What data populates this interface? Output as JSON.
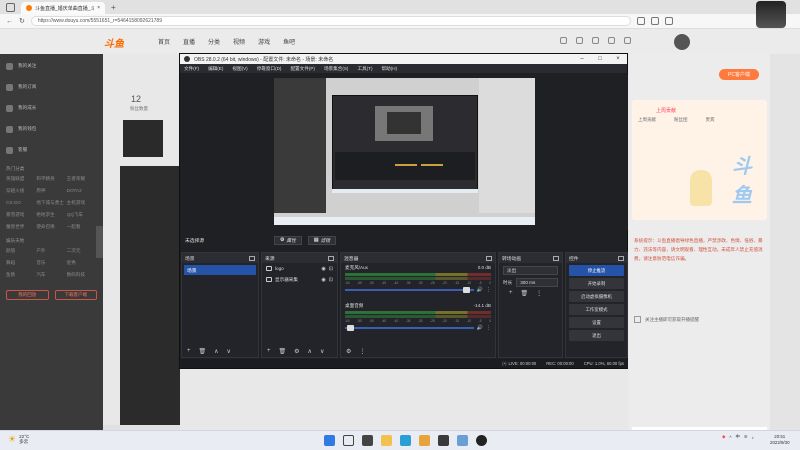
{
  "browser": {
    "tab_title": "斗鱼直播_婚庆单曲直播_斗...",
    "url": "https://www.douyu.com/5551651_r=5464158092621789"
  },
  "site": {
    "logo": "斗鱼",
    "nav": [
      "首页",
      "直播",
      "分类",
      "视频",
      "游戏",
      "鱼吧"
    ],
    "left_menu": [
      "我的关注",
      "我的订阅",
      "我的成长",
      "我的钱包",
      "客服"
    ],
    "sections": [
      {
        "title": "热门分类",
        "items": [
          "英雄联盟",
          "和平精英",
          "王者荣耀",
          "穿越火线",
          "原神",
          "DOTA2",
          "CS:GO",
          "地下城与勇士",
          "主机游戏",
          "暴雪游戏",
          "绝地求生",
          "QQ飞车",
          "魔兽世界",
          "使命召唤",
          "一起看"
        ]
      },
      {
        "title": "娱乐天地",
        "items": [
          "颜值",
          "户外",
          "二次元",
          "舞蹈",
          "音乐",
          "星秀",
          "鱼教",
          "汽车",
          "数码科技"
        ]
      }
    ],
    "left_buttons": [
      "我的回放",
      "下载客户端"
    ],
    "content_count": "12",
    "content_count_label": "粉丝数量",
    "right_button": "PC客户端",
    "right_tabs": [
      "上周贡献",
      "粉丝团",
      "贵宾"
    ],
    "right_card_header": "上周贡献",
    "right_watermark": "斗鱼",
    "right_notice": "系统提示：斗鱼直播倡导绿色直播，严禁涉政、色情、低俗、暴力、违法等内容，请文明观看、理性互动。未成年人禁止充值消费，请注意防范电信诈骗。",
    "right_note": "关注主播即可获取开播提醒"
  },
  "obs": {
    "title": "OBS 28.0.2 (64 bit, windows) - 配置文件: 未命名 - 场景: 未命名",
    "menu": [
      "文件(F)",
      "编辑(E)",
      "视图(V)",
      "停靠窗口(D)",
      "配置文件(P)",
      "场景集合(S)",
      "工具(T)",
      "帮助(H)"
    ],
    "no_source": "未选择源",
    "props_button": "属性",
    "filters_button": "滤镜",
    "docks": {
      "scenes": {
        "title": "场景",
        "items": [
          "场景"
        ]
      },
      "sources": {
        "title": "来源",
        "items": [
          "logo",
          "显示器采集"
        ]
      },
      "mixer": {
        "title": "混音器",
        "channels": [
          {
            "name": "麦克风/Aux",
            "db": "0.0 dB",
            "level": 0.95
          },
          {
            "name": "桌面音频",
            "db": "-14.1 dB",
            "level": 0.05
          }
        ],
        "scale": [
          "-60",
          "-55",
          "-50",
          "-45",
          "-40",
          "-35",
          "-30",
          "-25",
          "-20",
          "-15",
          "-10",
          "-5",
          "0"
        ]
      },
      "transitions": {
        "title": "转场动画",
        "type": "淡出",
        "duration_label": "时长",
        "duration": "300 ms"
      },
      "controls": {
        "title": "控件",
        "buttons": [
          "停止推流",
          "开始录制",
          "启动虚拟摄像机",
          "工作室模式",
          "设置",
          "退出"
        ]
      }
    },
    "status": {
      "live": "LIVE: 00:00:00",
      "rec": "REC: 00:00:00",
      "cpu": "CPU: 1.0%, 60.00 fps"
    }
  },
  "taskbar": {
    "temp": "22°C",
    "weather": "多云",
    "time": "20:51",
    "date": "2022/9/30",
    "lang": "中"
  },
  "colors": {
    "accent_blue": "#2553a8",
    "douyu_orange": "#ff6a00",
    "obs_bg": "#1f2024"
  }
}
